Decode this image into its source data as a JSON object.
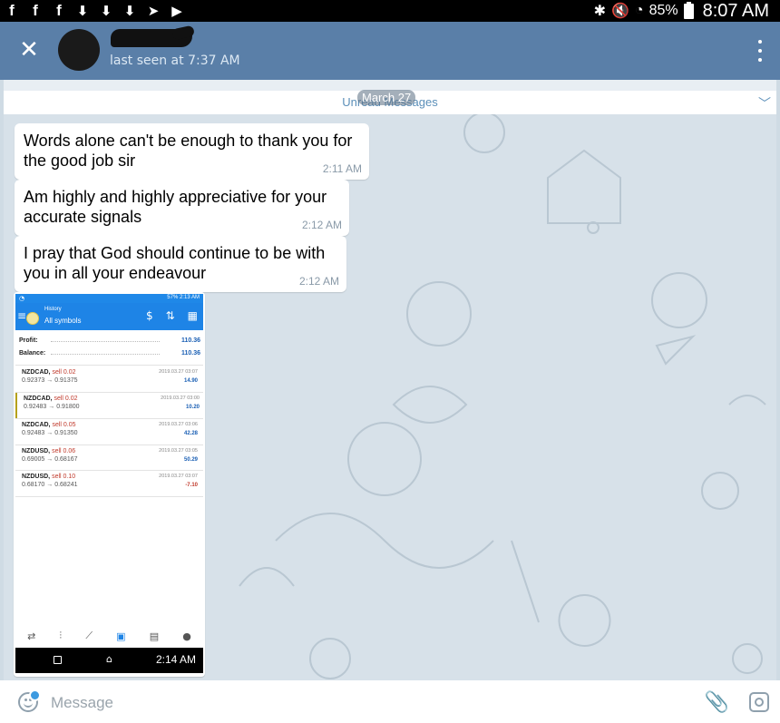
{
  "status_bar": {
    "left_icons": [
      "fb-icon",
      "fb-icon",
      "fb-icon",
      "download-icon",
      "download-icon",
      "download-icon",
      "telegram-icon",
      "play-icon"
    ],
    "battery": "85%",
    "time": "8:07 AM"
  },
  "header": {
    "close": "✕",
    "last_seen": "last seen at 7:37 AM"
  },
  "unread": {
    "label": "Unread Messages",
    "date": "March 27"
  },
  "messages": [
    {
      "text": "Words alone can't be enough to thank you for the good job sir",
      "time": "2:11 AM"
    },
    {
      "text": "Am highly and highly appreciative for your accurate signals",
      "time": "2:12 AM"
    },
    {
      "text": "I pray that God should continue to be with you in all your endeavour",
      "time": "2:12 AM"
    }
  ],
  "screenshot": {
    "status": "57% 2:13 AM",
    "history_label": "History",
    "symbols_label": "All symbols",
    "profit_label": "Profit:",
    "profit_value": "110.36",
    "balance_label": "Balance:",
    "balance_value": "110.36",
    "trades": [
      {
        "symbol": "NZDCAD,",
        "side": "sell 0.02",
        "prices": "0.92373 → 0.91375",
        "date": "2019.03.27 03:07",
        "pl": "14.90"
      },
      {
        "symbol": "NZDCAD,",
        "side": "sell 0.02",
        "prices": "0.92483 → 0.91800",
        "date": "2019.03.27 03:00",
        "pl": "10.20"
      },
      {
        "symbol": "NZDCAD,",
        "side": "sell 0.05",
        "prices": "0.92483 → 0.91350",
        "date": "2019.03.27 03:06",
        "pl": "42.28"
      },
      {
        "symbol": "NZDUSD,",
        "side": "sell 0.06",
        "prices": "0.69005 → 0.68167",
        "date": "2019.03.27 03:05",
        "pl": "50.29"
      },
      {
        "symbol": "NZDUSD,",
        "side": "sell 0.10",
        "prices": "0.68170 → 0.68241",
        "date": "2019.03.27 03:07",
        "pl": "-7.10"
      }
    ],
    "nav_time": "2:14 AM"
  },
  "input": {
    "placeholder": "Message"
  },
  "colors": {
    "app_bar": "#5a7fa8",
    "accent": "#5b8fb9",
    "chat_bg": "#d7e1e9"
  }
}
